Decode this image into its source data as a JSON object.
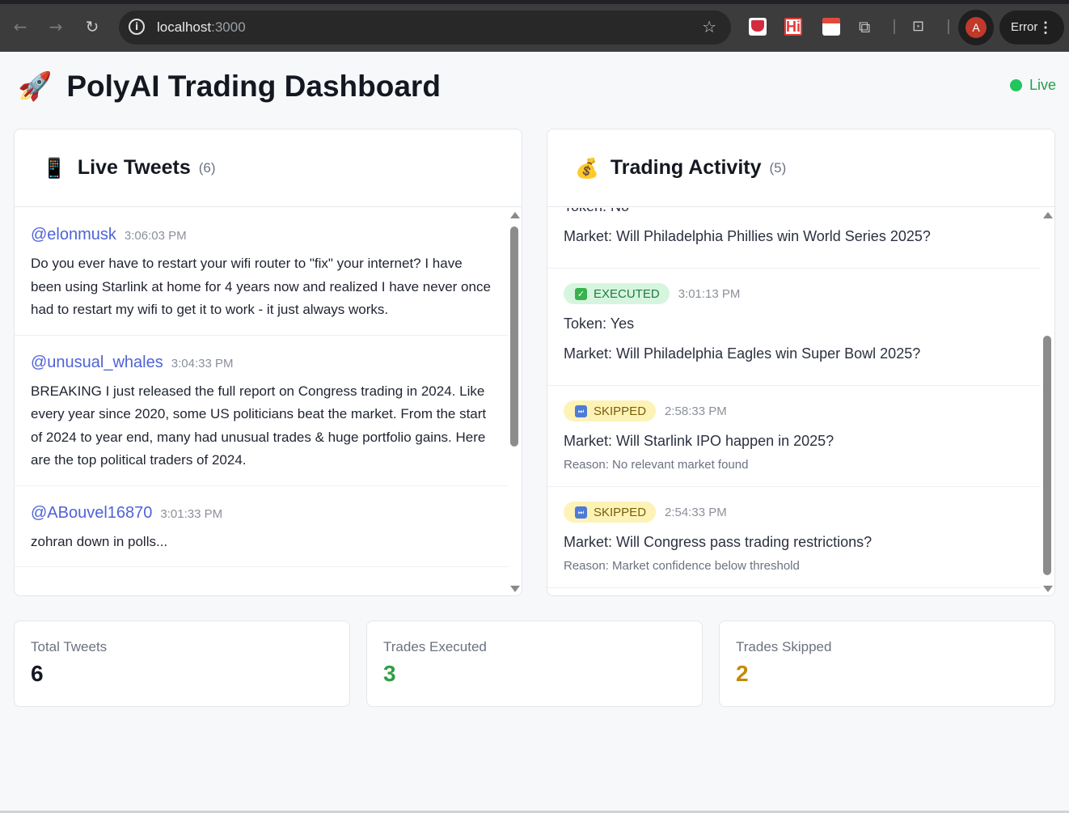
{
  "browser": {
    "url_host": "localhost",
    "url_port": ":3000",
    "profile_initial": "A",
    "error_label": "Error",
    "hi_ext_label": "Hi"
  },
  "header": {
    "title": "PolyAI Trading Dashboard",
    "status": "Live"
  },
  "tweets_panel": {
    "title": "Live Tweets",
    "count": "(6)",
    "items": [
      {
        "handle": "@elonmusk",
        "time": "3:06:03 PM",
        "text": "Do you ever have to restart your wifi router to \"fix\" your internet? I have been using Starlink at home for 4 years now and realized I have never once had to restart my wifi to get it to work - it just always works."
      },
      {
        "handle": "@unusual_whales",
        "time": "3:04:33 PM",
        "text": "BREAKING I just released the full report on Congress trading in 2024. Like every year since 2020, some US politicians beat the market. From the start of 2024 to year end, many had unusual trades & huge portfolio gains. Here are the top political traders of 2024."
      },
      {
        "handle": "@ABouvel16870",
        "time": "3:01:33 PM",
        "text": "zohran down in polls..."
      }
    ]
  },
  "trades_panel": {
    "title": "Trading Activity",
    "count": "(5)",
    "partial_top": {
      "token": "Token: No",
      "market": "Market: Will Philadelphia Phillies win World Series 2025?"
    },
    "items": [
      {
        "status": "EXECUTED",
        "time": "3:01:13 PM",
        "token": "Token: Yes",
        "market": "Market: Will Philadelphia Eagles win Super Bowl 2025?"
      },
      {
        "status": "SKIPPED",
        "time": "2:58:33 PM",
        "market": "Market: Will Starlink IPO happen in 2025?",
        "reason": "Reason: No relevant market found"
      },
      {
        "status": "SKIPPED",
        "time": "2:54:33 PM",
        "market": "Market: Will Congress pass trading restrictions?",
        "reason": "Reason: Market confidence below threshold"
      }
    ]
  },
  "stats": {
    "total_tweets": {
      "label": "Total Tweets",
      "value": "6",
      "color": "#141821"
    },
    "trades_executed": {
      "label": "Trades Executed",
      "value": "3",
      "color": "#2f9e44"
    },
    "trades_skipped": {
      "label": "Trades Skipped",
      "value": "2",
      "color": "#c38a0b"
    }
  },
  "icons": {
    "rocket": "🚀",
    "tweets": "📱",
    "trading": "💰",
    "executed": "✓",
    "skipped": "⏭"
  }
}
